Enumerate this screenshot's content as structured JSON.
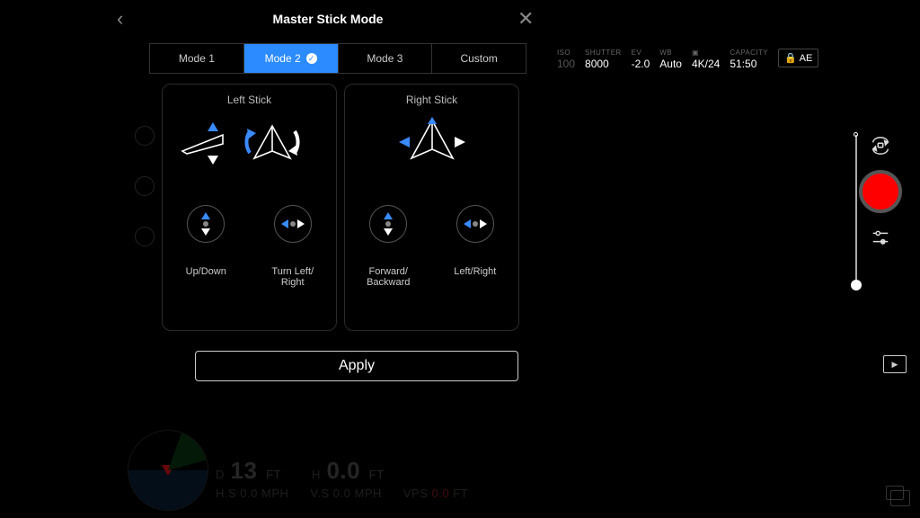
{
  "header": {
    "title": "Master Stick Mode",
    "back_icon": "‹",
    "close_icon": "✕"
  },
  "tabs": {
    "items": [
      {
        "label": "Mode 1",
        "active": false
      },
      {
        "label": "Mode 2",
        "active": true
      },
      {
        "label": "Mode 3",
        "active": false
      },
      {
        "label": "Custom",
        "active": false
      }
    ]
  },
  "left_stick": {
    "title": "Left Stick",
    "control1_label": "Up/Down",
    "control2_label": "Turn Left/\nRight"
  },
  "right_stick": {
    "title": "Right Stick",
    "control1_label": "Forward/\nBackward",
    "control2_label": "Left/Right"
  },
  "apply_label": "Apply",
  "camera": {
    "iso": {
      "label": "ISO",
      "value": "100"
    },
    "shutter": {
      "label": "SHUTTER",
      "value": "8000"
    },
    "ev": {
      "label": "EV",
      "value": "-2.0"
    },
    "wb": {
      "label": "WB",
      "value": "Auto"
    },
    "format": {
      "label": "▣",
      "value": "4K/24"
    },
    "capacity": {
      "label": "CAPACITY",
      "value": "51:50"
    },
    "ae_lock": "AE"
  },
  "telemetry": {
    "d_prefix": "D",
    "d_value": "13",
    "d_unit": "FT",
    "h_prefix": "H",
    "h_value": "0.0",
    "h_unit": "FT",
    "hs_label": "H.S",
    "hs_value": "0.0",
    "hs_unit": "MPH",
    "vs_label": "V.S",
    "vs_value": "0.0",
    "vs_unit": "MPH",
    "vps_label": "VPS",
    "vps_value": "0.0",
    "vps_unit": "FT"
  }
}
